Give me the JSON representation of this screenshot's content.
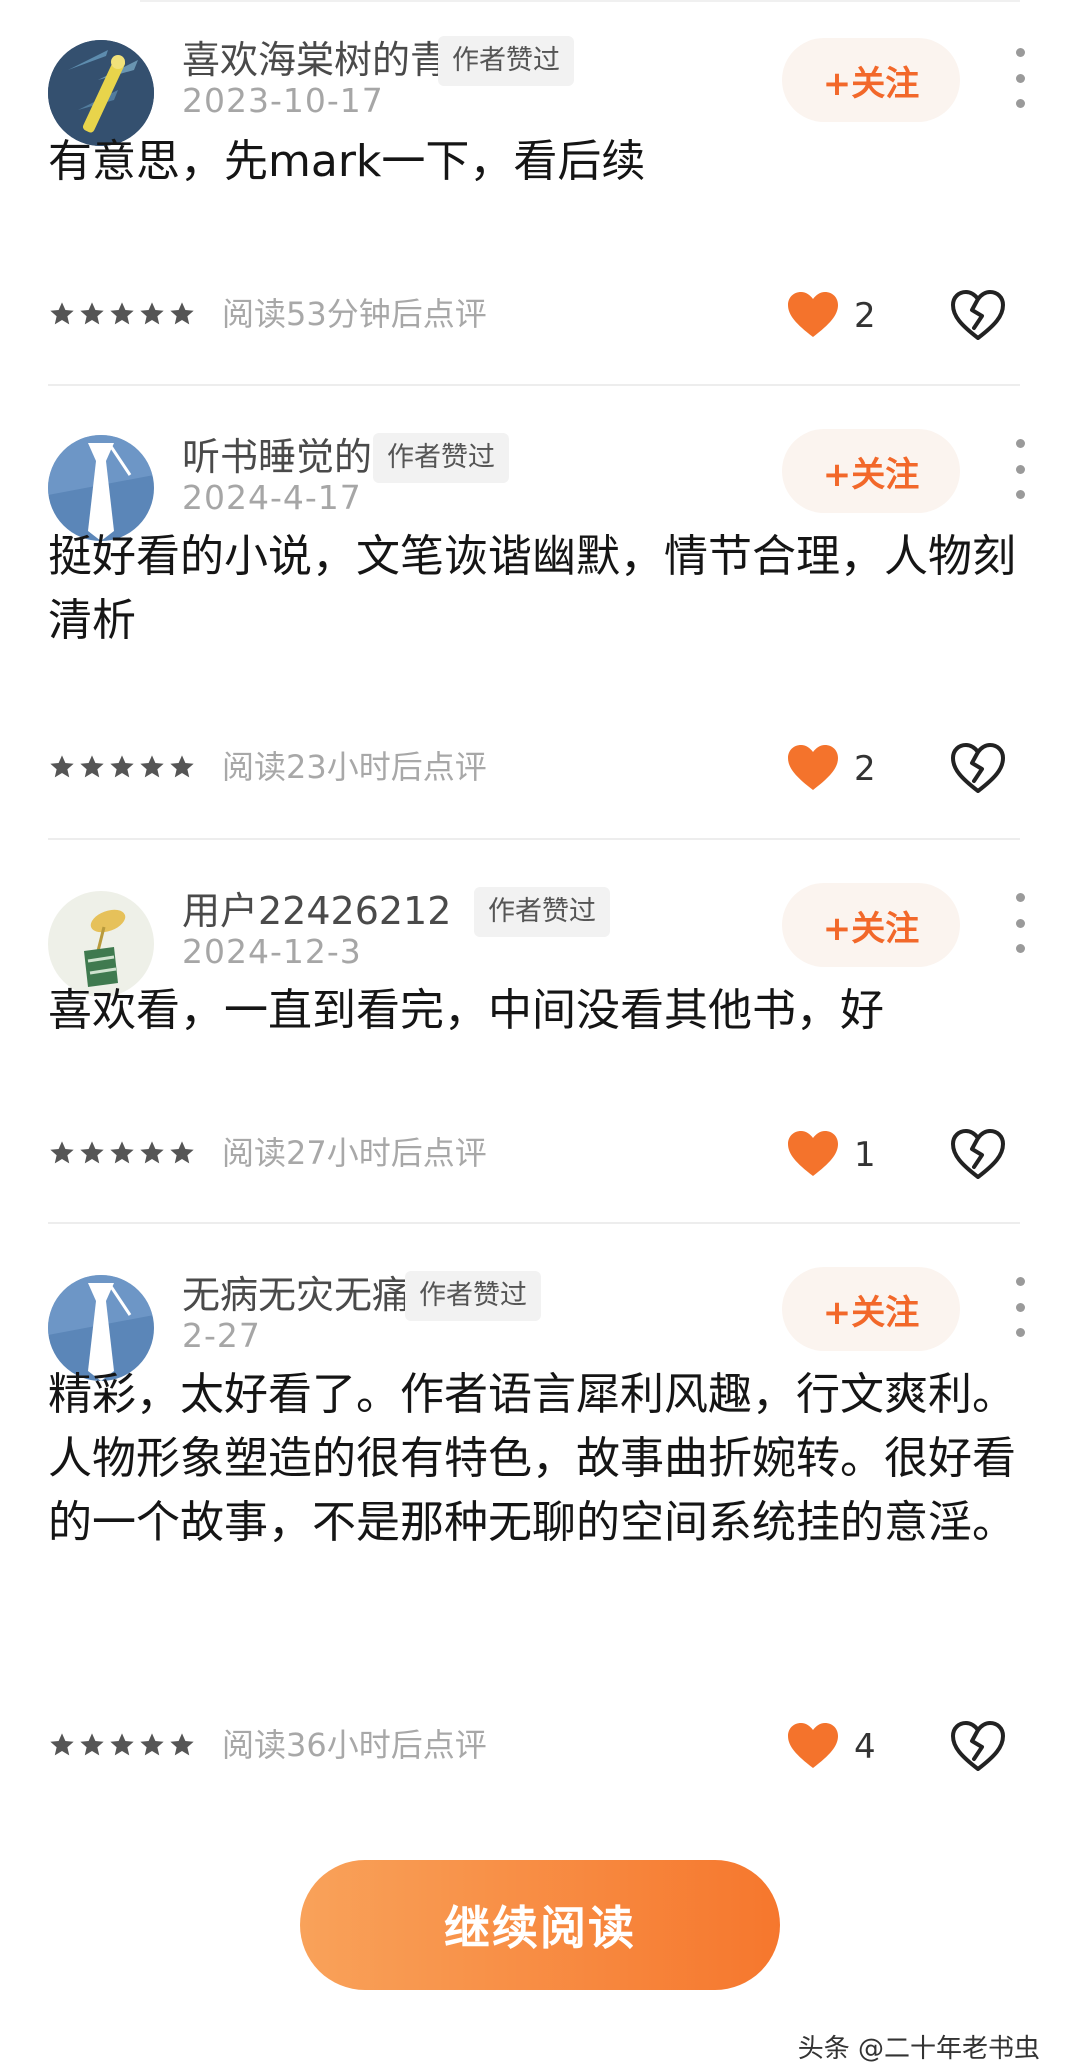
{
  "comments": [
    {
      "username": "喜欢海棠树的青甲龙",
      "badge": "作者赞过",
      "date": "2023-10-17",
      "follow_label": "+关注",
      "content": "有意思，先mark一下，看后续",
      "read_note": "阅读53分钟后点评",
      "rating": 5,
      "likes": "2",
      "avatar": "dragonfly-avatar"
    },
    {
      "username": "听书睡觉的书虫",
      "badge": "作者赞过",
      "date": "2024-4-17",
      "follow_label": "+关注",
      "content": "挺好看的小说，文笔诙谐幽默，情节合理，人物刻清析",
      "read_note": "阅读23小时后点评",
      "rating": 5,
      "likes": "2",
      "avatar": "tie-avatar"
    },
    {
      "username": "用户22426212",
      "badge": "作者赞过",
      "date": "2024-12-3",
      "follow_label": "+关注",
      "content": "喜欢看，一直到看完，中间没看其他书，好",
      "read_note": "阅读27小时后点评",
      "rating": 5,
      "likes": "1",
      "avatar": "plant-avatar"
    },
    {
      "username": "无病无灾无痛无难",
      "badge": "作者赞过",
      "date": "2-27",
      "follow_label": "+关注",
      "content": "精彩，太好看了。作者语言犀利风趣，行文爽利。人物形象塑造的很有特色，故事曲折婉转。很好看的一个故事，不是那种无聊的空间系统挂的意淫。",
      "read_note": "阅读36小时后点评",
      "rating": 5,
      "likes": "4",
      "avatar": "tie-avatar"
    }
  ],
  "continue_label": "继续阅读",
  "watermark": "头条 @二十年老书虫",
  "colors": {
    "accent": "#f2682a",
    "heart": "#f4732c",
    "follow_bg": "#fbf4ef"
  }
}
